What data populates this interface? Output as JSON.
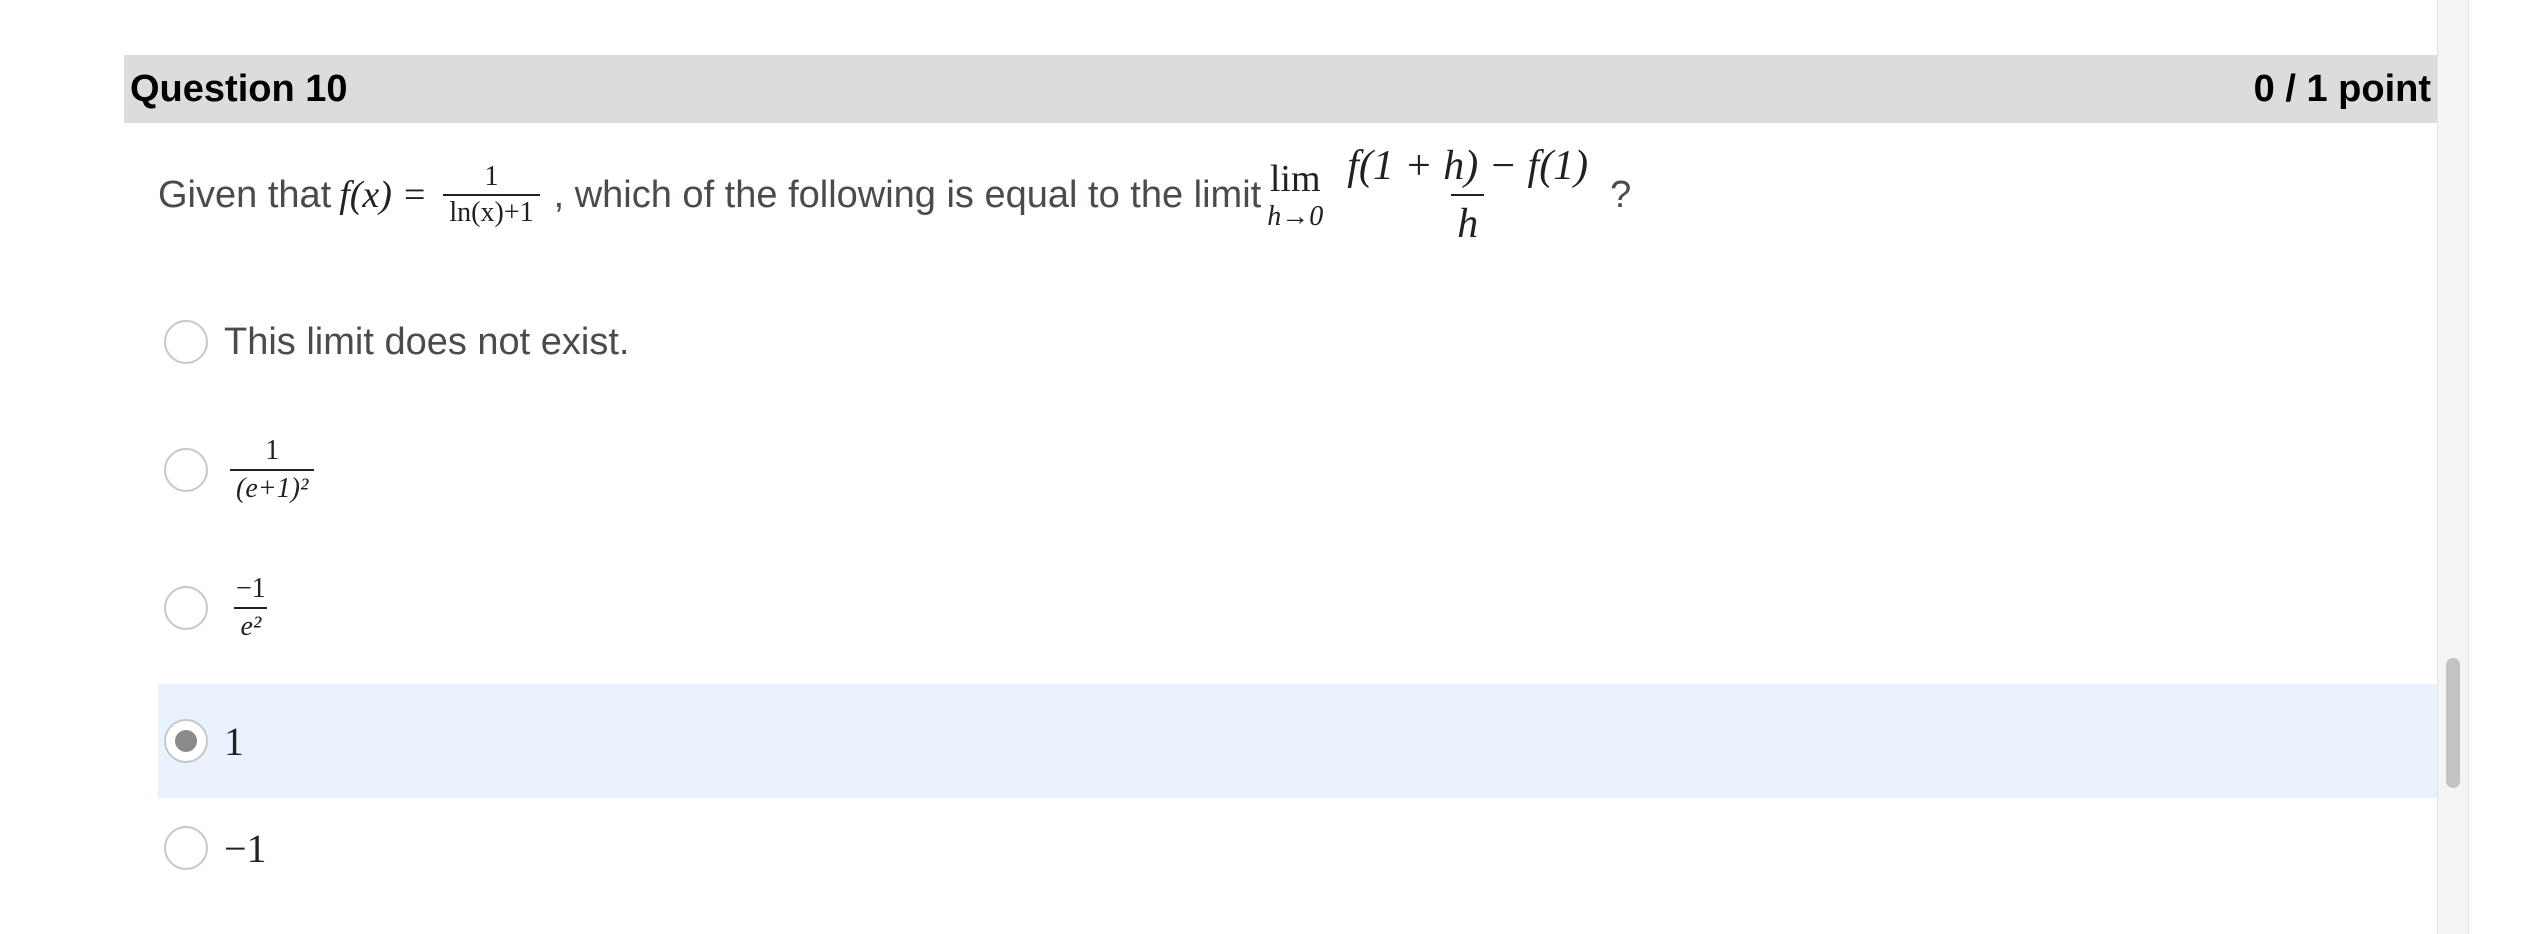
{
  "question": {
    "title": "Question 10",
    "score": "0 / 1 point"
  },
  "prompt": {
    "lead": "Given that",
    "fx": "f(x)",
    "eq": "=",
    "frac_num": "1",
    "frac_den": "ln(x)+1",
    "middle": ", which  of the following is equal to the limit",
    "lim": "lim",
    "lim_sub": "h→0",
    "limit_num": "f(1 + h) − f(1)",
    "limit_den": "h",
    "end": "?"
  },
  "options": [
    {
      "text": "This limit does not exist.",
      "selected": false
    },
    {
      "num": "1",
      "den": "(e+1)²",
      "selected": false
    },
    {
      "num": "−1",
      "den": "e²",
      "selected": false
    },
    {
      "text": "1",
      "selected": true
    },
    {
      "text": "−1",
      "selected": false
    }
  ],
  "colors": {
    "header_bg": "#dcdcdc",
    "selected_bg": "#e9f2fd",
    "text": "#494c4e"
  }
}
